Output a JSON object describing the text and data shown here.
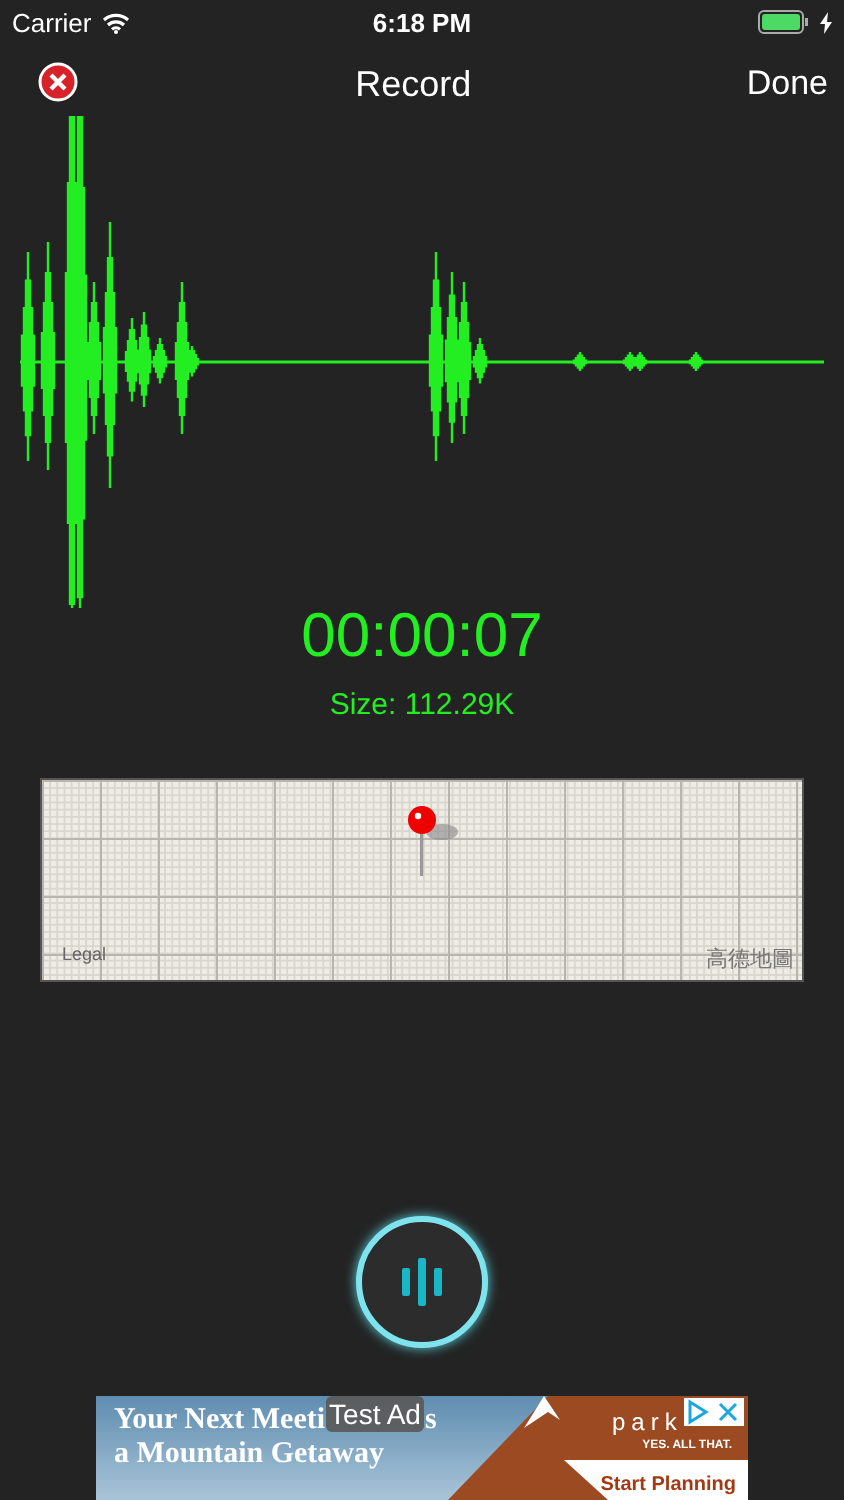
{
  "status_bar": {
    "carrier": "Carrier",
    "time": "6:18 PM",
    "charging": true
  },
  "nav": {
    "title": "Record",
    "done": "Done"
  },
  "timer": "00:00:07",
  "size": "Size: 112.29K",
  "map": {
    "legal": "Legal",
    "provider": "高德地圖"
  },
  "ad": {
    "headline_start": "Your Next Meeti",
    "headline_end": "s",
    "headline_line2": "a Mountain Getaway",
    "label": "Test Ad",
    "brand": "park",
    "tagline": "YES. ALL THAT.",
    "cta": "Start Planning"
  }
}
